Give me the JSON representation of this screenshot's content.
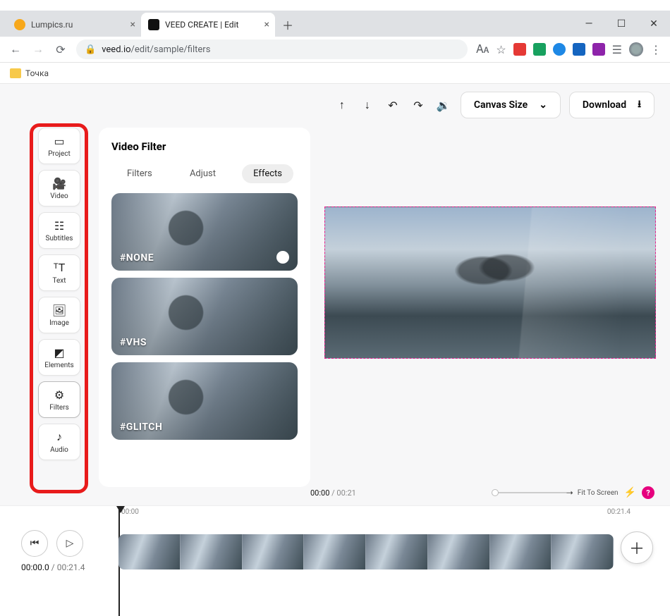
{
  "browser": {
    "tabs": [
      {
        "title": "Lumpics.ru",
        "active": false
      },
      {
        "title": "VEED CREATE | Edit",
        "active": true
      }
    ],
    "url_host": "veed.io",
    "url_path": "/edit/sample/filters",
    "bookmark": "Точка"
  },
  "topbar": {
    "canvas_size": "Canvas Size",
    "download": "Download"
  },
  "sidebar": {
    "items": [
      {
        "label": "Project"
      },
      {
        "label": "Video"
      },
      {
        "label": "Subtitles"
      },
      {
        "label": "Text"
      },
      {
        "label": "Image"
      },
      {
        "label": "Elements"
      },
      {
        "label": "Filters"
      },
      {
        "label": "Audio"
      }
    ]
  },
  "panel": {
    "title": "Video Filter",
    "tab_filters": "Filters",
    "tab_adjust": "Adjust",
    "tab_effects": "Effects",
    "effects": [
      {
        "label": "#NONE",
        "selected": true
      },
      {
        "label": "#VHS",
        "selected": false
      },
      {
        "label": "#GLITCH",
        "selected": false
      }
    ]
  },
  "midrow": {
    "time_current": "00:00",
    "time_total": "00:21",
    "fit": "Fit To Screen",
    "help": "?"
  },
  "timeline": {
    "ruler_start": "00:00",
    "ruler_end": "00:21.4",
    "counter_current": "00:00.0",
    "counter_total": "00:21.4"
  }
}
